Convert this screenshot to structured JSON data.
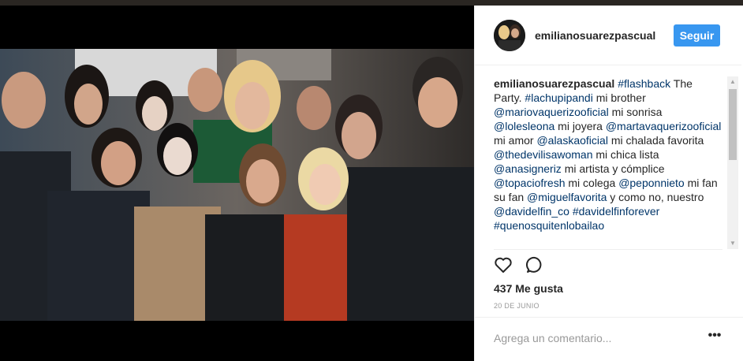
{
  "post": {
    "username": "emilianosuarezpascual",
    "follow_label": "Seguir",
    "caption": [
      {
        "t": "emilianosuarezpascual",
        "k": "user"
      },
      {
        "t": " ",
        "k": "text"
      },
      {
        "t": "#flashback",
        "k": "link"
      },
      {
        "t": " The Party. ",
        "k": "text"
      },
      {
        "t": "#lachupipandi",
        "k": "link"
      },
      {
        "t": " mi brother ",
        "k": "text"
      },
      {
        "t": "@mariovaquerizooficial",
        "k": "link"
      },
      {
        "t": " mi sonrisa ",
        "k": "text"
      },
      {
        "t": "@lolesleona",
        "k": "link"
      },
      {
        "t": " mi joyera ",
        "k": "text"
      },
      {
        "t": "@martavaquerizooficial",
        "k": "link"
      },
      {
        "t": " mi amor ",
        "k": "text"
      },
      {
        "t": "@alaskaoficial",
        "k": "link"
      },
      {
        "t": " mi chalada favorita ",
        "k": "text"
      },
      {
        "t": "@thedevilisawoman",
        "k": "link"
      },
      {
        "t": " mi chica lista ",
        "k": "text"
      },
      {
        "t": "@anasigneriz",
        "k": "link"
      },
      {
        "t": " mi artista y cómplice ",
        "k": "text"
      },
      {
        "t": "@topaciofresh",
        "k": "link"
      },
      {
        "t": " mi colega ",
        "k": "text"
      },
      {
        "t": "@peponnieto",
        "k": "link"
      },
      {
        "t": " mi fan su fan ",
        "k": "text"
      },
      {
        "t": "@miguelfavorita",
        "k": "link"
      },
      {
        "t": " y como no, nuestro ",
        "k": "text"
      },
      {
        "t": "@davidelfin_co",
        "k": "link"
      },
      {
        "t": " ",
        "k": "text"
      },
      {
        "t": "#davidelfinforever",
        "k": "link"
      },
      {
        "t": " ",
        "k": "text"
      },
      {
        "t": "#quenosquitenlobailao",
        "k": "link"
      }
    ],
    "likes": "437 Me gusta",
    "date": "20 DE JUNIO",
    "comment_placeholder": "Agrega un comentario...",
    "more_label": "•••"
  },
  "icons": {
    "like": "heart-icon",
    "comment": "comment-bubble-icon",
    "more": "more-options-icon",
    "scroll_up": "scroll-up-arrow-icon",
    "scroll_down": "scroll-down-arrow-icon"
  },
  "colors": {
    "follow_button": "#3897f0",
    "link": "#003569",
    "text": "#262626",
    "muted": "#999999"
  }
}
